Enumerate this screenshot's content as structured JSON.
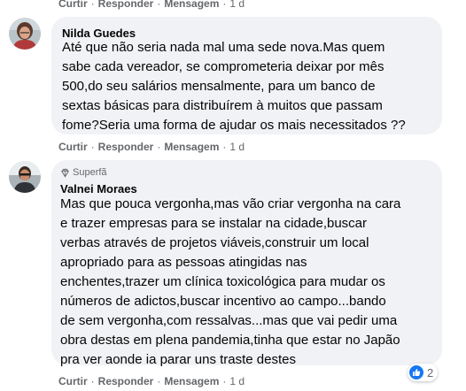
{
  "comments": [
    {
      "author": "Nilda Guedes",
      "text": "Até que não seria nada mal uma sede nova.Mas quem\nsabe cada vereador, se comprometeria deixar por mês\n500,do seu salários mensalmente, para um banco de\nsextas básicas para distribuírem à muitos que passam\nfome?Seria uma forma de ajudar os mais necessitados ??",
      "actions": {
        "like": "Curtir",
        "reply": "Responder",
        "message": "Mensagem",
        "time": "1 d"
      }
    },
    {
      "author": "Valnei Moraes",
      "badge": "Superfã",
      "text": "Mas que pouca vergonha,mas vão criar vergonha na cara\ne trazer empresas para se instalar na cidade,buscar\nverbas através de projetos viáveis,construir um local\napropriado para as pessoas atingidas nas\nenchentes,trazer um clínica toxicológica para mudar os\nnúmeros de adictos,buscar incentivo ao campo...bando\nde sem vergonha,com ressalvas...mas que vai pedir uma\nobra destas em plena pandemia,tinha que estar no Japão\npra ver aonde ia parar uns traste destes",
      "reaction_count": "2",
      "actions": {
        "like": "Curtir",
        "reply": "Responder",
        "message": "Mensagem",
        "time": "1 d"
      }
    }
  ],
  "top_actions": {
    "like": "Curtir",
    "reply": "Responder",
    "message": "Mensagem",
    "time": "1 d"
  },
  "colors": {
    "bubble": "#f0f2f5",
    "muted": "#65676b",
    "like_blue": "#1877f2"
  }
}
